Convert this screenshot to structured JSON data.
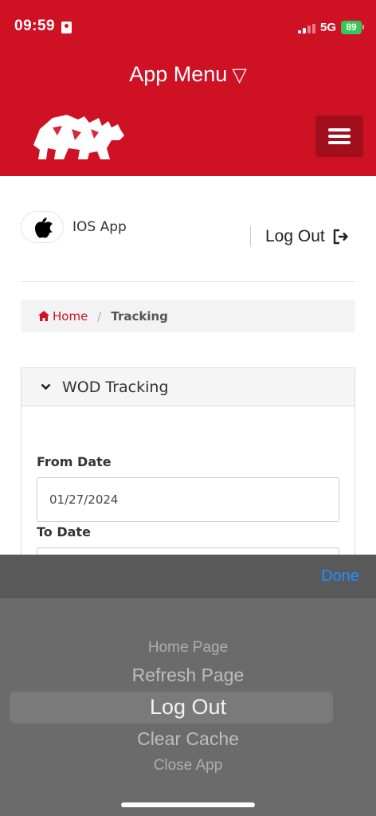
{
  "status_bar": {
    "time": "09:59",
    "network": "5G",
    "battery": "89"
  },
  "header": {
    "menu_title": "App Menu",
    "menu_caret": "▽",
    "logo_icon": "rhino-logo-icon",
    "menu_icon": "hamburger-icon"
  },
  "user": {
    "avatar_icon": "apple-icon",
    "name": "IOS App",
    "logout_label": "Log Out"
  },
  "breadcrumb": {
    "home": "Home",
    "separator": "/",
    "current": "Tracking"
  },
  "panel": {
    "title": "WOD Tracking",
    "from_label": "From Date",
    "from_value": "01/27/2024",
    "to_label": "To Date",
    "to_value": ""
  },
  "picker": {
    "done_label": "Done",
    "options": [
      "Home Page",
      "Refresh Page",
      "Log Out",
      "Clear Cache",
      "Close App"
    ],
    "selected": "Log Out"
  },
  "colors": {
    "brand_red": "#cf1124",
    "hamburger_bg": "#a10e1c",
    "done_blue": "#1e90ff",
    "battery_green": "#34c759"
  }
}
